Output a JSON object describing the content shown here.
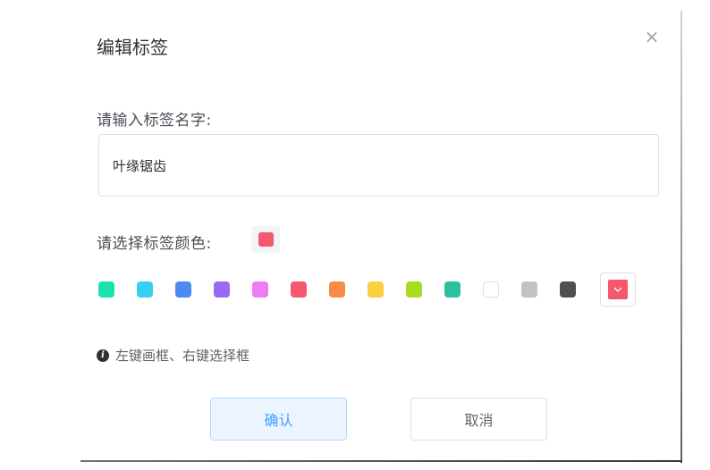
{
  "dialog": {
    "title": "编辑标签",
    "close_icon": "close-icon"
  },
  "name_field": {
    "label": "请输入标签名字:",
    "value": "叶缘锯齿"
  },
  "color_field": {
    "label": "请选择标签颜色:",
    "selected_color": "#f5576c",
    "swatches": [
      "#1de2b0",
      "#36d1f0",
      "#4b8bf0",
      "#9b6af5",
      "#ee7df0",
      "#f5576c",
      "#f58d46",
      "#fbcf3f",
      "#aadb1e",
      "#2ebfa0",
      "#ffffff",
      "#bfc2c6",
      "#4d4f52"
    ],
    "picker_color": "#f5576c",
    "picker_icon": "chevron-down-icon"
  },
  "hint": {
    "icon": "info-icon",
    "text": "左键画框、右键选择框"
  },
  "buttons": {
    "confirm": "确认",
    "cancel": "取消"
  }
}
